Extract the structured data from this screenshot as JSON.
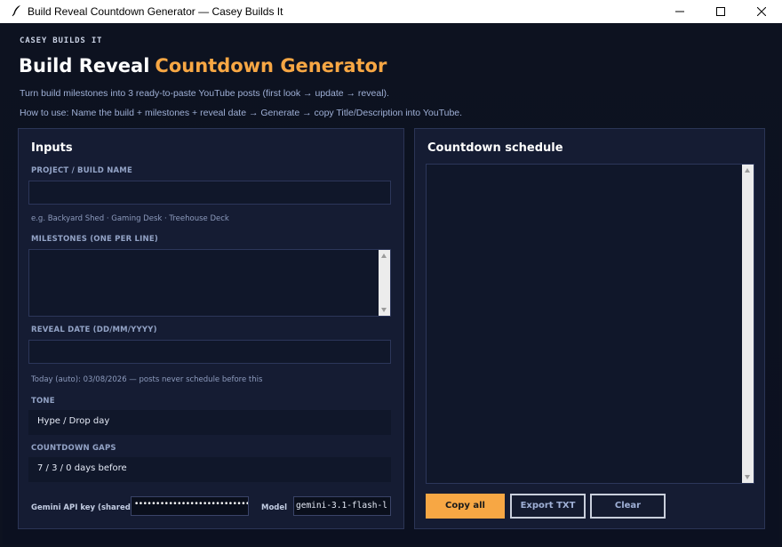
{
  "window": {
    "title": "Build Reveal Countdown Generator — Casey Builds It",
    "controls": {
      "minimize": "minimize-icon",
      "maximize": "maximize-icon",
      "close": "close-icon"
    }
  },
  "header": {
    "brand": "CASEY BUILDS IT",
    "title_main": "Build Reveal",
    "title_accent": "Countdown Generator",
    "subtitle": "Turn build milestones into 3 ready-to-paste YouTube posts (first look → update → reveal).",
    "how_to": "How to use: Name the build + milestones + reveal date → Generate → copy Title/Description into YouTube."
  },
  "inputs": {
    "title": "Inputs",
    "project_label": "PROJECT / BUILD NAME",
    "project_value": "",
    "project_hint": "e.g. Backyard Shed · Gaming Desk · Treehouse Deck",
    "milestones_label": "MILESTONES (ONE PER LINE)",
    "milestones_value": "",
    "reveal_label": "REVEAL DATE (DD/MM/YYYY)",
    "reveal_value": "",
    "today_hint": "Today (auto): 03/08/2026 — posts never schedule before this",
    "tone_label": "TONE",
    "tone_value": "Hype / Drop day",
    "gaps_label": "COUNTDOWN GAPS",
    "gaps_value": "7 / 3 / 0 days before",
    "api_label": "Gemini API key (shared)",
    "api_value": "••••••••••••••••••••••••••••••",
    "model_label": "Model",
    "model_value": "gemini-3.1-flash-l"
  },
  "output": {
    "title": "Countdown schedule",
    "text": "",
    "copy_label": "Copy all",
    "export_label": "Export TXT",
    "clear_label": "Clear"
  },
  "colors": {
    "accent": "#f7a744",
    "background": "#0d1220",
    "panel": "#151c33",
    "field": "#10172a"
  }
}
